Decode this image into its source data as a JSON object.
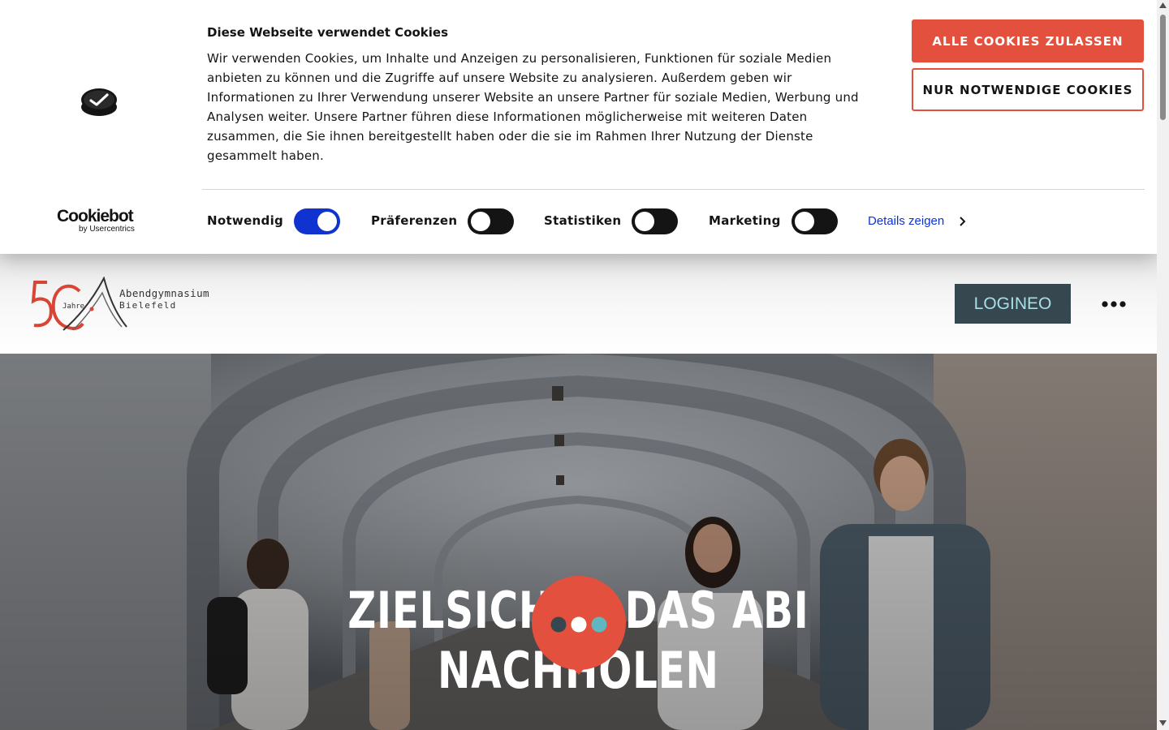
{
  "cookie_banner": {
    "title": "Diese Webseite verwendet Cookies",
    "text": "Wir verwenden Cookies, um Inhalte und Anzeigen zu personalisieren, Funktionen für soziale Medien anbieten zu können und die Zugriffe auf unsere Website zu analysieren. Außerdem geben wir Informationen zu Ihrer Verwendung unserer Website an unsere Partner für soziale Medien, Werbung und Analysen weiter. Unsere Partner führen diese Informationen möglicherweise mit weiteren Daten zusammen, die Sie ihnen bereitgestellt haben oder die sie im Rahmen Ihrer Nutzung der Dienste gesammelt haben.",
    "accept_all_label": "ALLE COOKIES ZULASSEN",
    "necessary_only_label": "NUR NOTWENDIGE COOKIES",
    "provider_logo": "Cookiebot",
    "provider_sub": "by Usercentrics",
    "consents": [
      {
        "label": "Notwendig",
        "enabled": true
      },
      {
        "label": "Präferenzen",
        "enabled": false
      },
      {
        "label": "Statistiken",
        "enabled": false
      },
      {
        "label": "Marketing",
        "enabled": false
      }
    ],
    "details_label": "Details zeigen",
    "icons": [
      "cookie-check-icon",
      "chevron-right-icon"
    ],
    "colors": {
      "accent": "#e3503e",
      "toggle_on": "#1032cf",
      "toggle_off": "#141414",
      "link": "#1032cf"
    }
  },
  "header": {
    "logo_line1": "Abendgymnasium",
    "logo_line2": "Bielefeld",
    "logo_jahre": "Jahre",
    "logo_number": "50",
    "logineo_label": "LOGINEO",
    "menu_icon": "more-horizontal-icon",
    "colors": {
      "logineo_bg": "#37474f",
      "logineo_text": "#a7dfe7",
      "logo_red": "#d84534"
    }
  },
  "hero": {
    "headline_line1": "ZIELSICHER DAS ABI",
    "headline_line2": "NACHHOLEN",
    "chat_icon": "chat-bubble-icon",
    "colors": {
      "chat_bg": "#e3503e"
    }
  }
}
